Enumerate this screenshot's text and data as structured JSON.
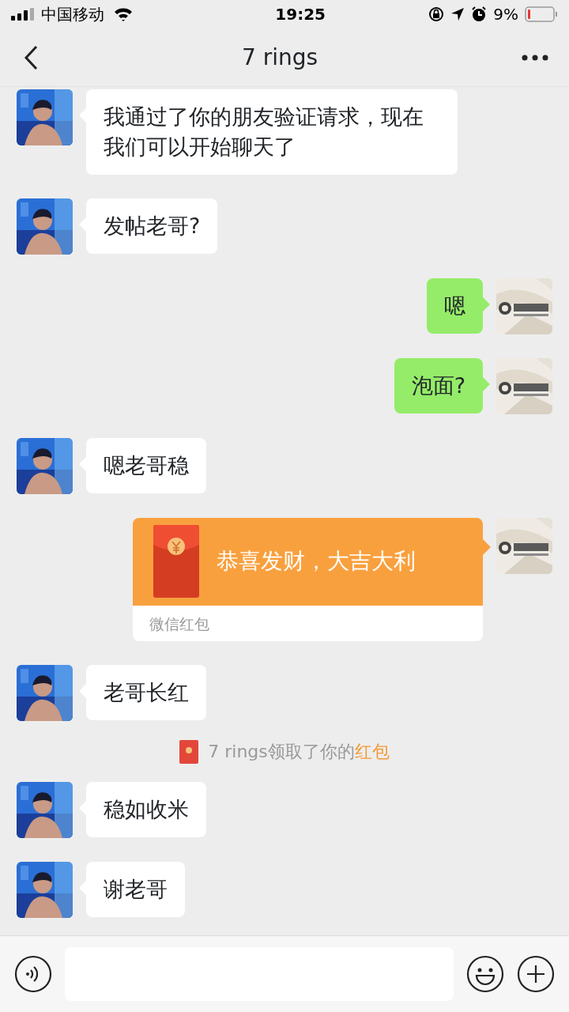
{
  "status_bar": {
    "carrier": "中国移动",
    "time": "19:25",
    "battery_percent": "9%"
  },
  "nav": {
    "title": "7 rings"
  },
  "messages": [
    {
      "kind": "incoming_text",
      "text": "我通过了你的朋友验证请求，现在我们可以开始聊天了"
    },
    {
      "kind": "incoming_text",
      "text": "发帖老哥?"
    },
    {
      "kind": "outgoing_text",
      "text": "嗯"
    },
    {
      "kind": "outgoing_text",
      "text": "泡面?"
    },
    {
      "kind": "incoming_text",
      "text": "嗯老哥稳"
    },
    {
      "kind": "outgoing_envelope",
      "text": "恭喜发财，大吉大利",
      "footer": "微信红包"
    },
    {
      "kind": "incoming_text",
      "text": "老哥长红"
    },
    {
      "kind": "notice",
      "text": "7 rings领取了你的",
      "link": "红包"
    },
    {
      "kind": "incoming_text",
      "text": "稳如收米"
    },
    {
      "kind": "incoming_text",
      "text": "谢老哥"
    }
  ]
}
